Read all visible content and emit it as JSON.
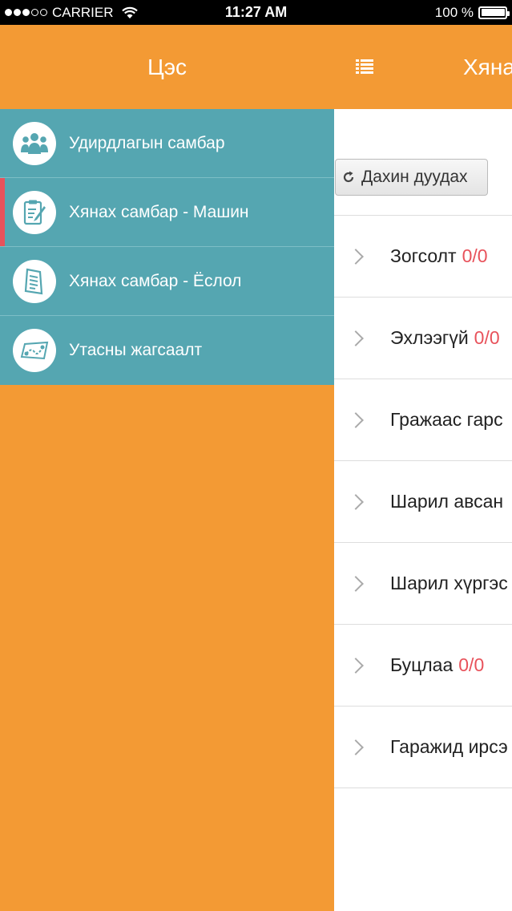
{
  "statusbar": {
    "carrier": "CARRIER",
    "time": "11:27 AM",
    "battery": "100 %",
    "battery_level": 1.0
  },
  "header": {
    "menu_title": "Цэс",
    "title": "Хяна",
    "list_icon": "list-icon"
  },
  "sidemenu": {
    "items": [
      {
        "label": "Удирдлагын самбар",
        "icon": "group-icon"
      },
      {
        "label": "Хянах самбар - Машин",
        "icon": "clipboard-icon",
        "active": true
      },
      {
        "label": "Хянах самбар - Ёслол",
        "icon": "document-icon"
      },
      {
        "label": "Утасны жагсаалт",
        "icon": "map-route-icon"
      }
    ]
  },
  "main": {
    "reload_label": "Дахин дуудах",
    "rows": [
      {
        "label": "Зогсолт",
        "count": "0/0"
      },
      {
        "label": "Эхлээгүй",
        "count": "0/0"
      },
      {
        "label": "Гражаас гарс",
        "count": ""
      },
      {
        "label": "Шарил авсан",
        "count": ""
      },
      {
        "label": "Шарил хүргэс",
        "count": ""
      },
      {
        "label": "Буцлаа",
        "count": "0/0"
      },
      {
        "label": "Гаражид ирсэ",
        "count": ""
      }
    ]
  },
  "colors": {
    "accent": "#f39a34",
    "menu_bg": "#55a6b1",
    "active_marker": "#e8525b",
    "count": "#e8525b"
  }
}
